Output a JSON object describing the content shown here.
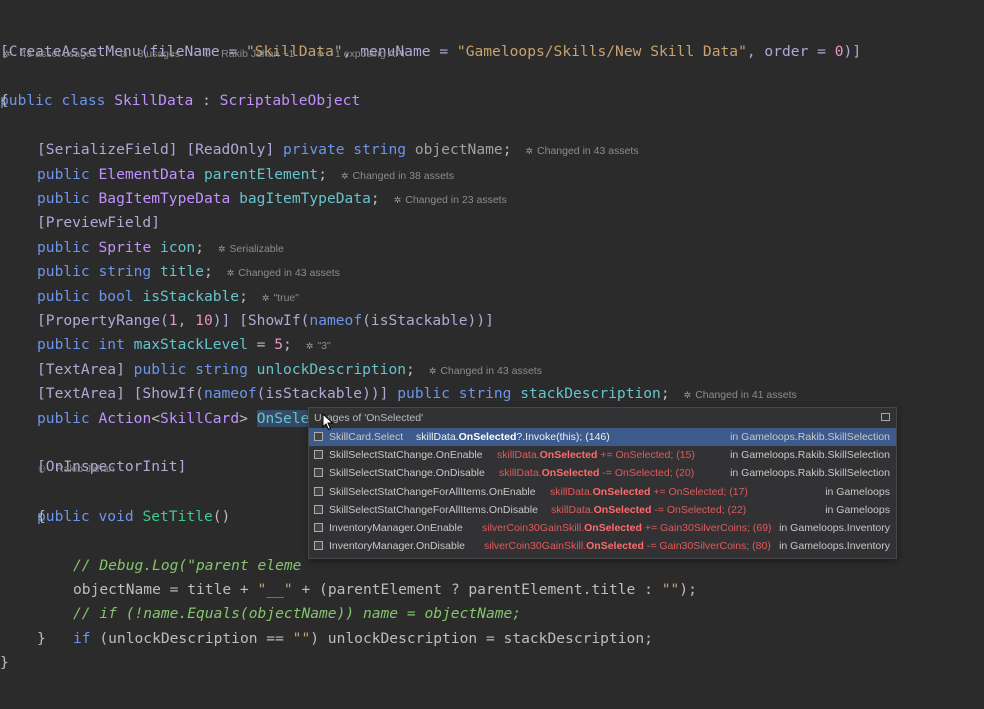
{
  "meta": {
    "asset_usages": "43 asset usages",
    "usages": "8 usages",
    "author": "Rakib Jahan +1",
    "exposing": "1 exposing API"
  },
  "code": {
    "attr_line": [
      "[CreateAssetMenu(fileName = ",
      "\"SkillData\"",
      ", menuName = ",
      "\"Gameloops/Skills/New Skill Data\"",
      ", order = ",
      "0",
      ")]"
    ],
    "class_kw": "public class ",
    "class_name": "SkillData",
    "class_sep": " : ",
    "class_base": "ScriptableObject",
    "open_brace": "{",
    "close_brace": "}",
    "inner_open": "{",
    "inner_close": "}",
    "l1": {
      "a": "[SerializeField] [ReadOnly] ",
      "b": "private string ",
      "c": "objectName",
      "d": ";",
      "hint": "Changed in 43 assets"
    },
    "l2": {
      "a": "public ",
      "b": "ElementData ",
      "c": "parentElement",
      "d": ";",
      "hint": "Changed in 38 assets"
    },
    "l3": {
      "a": "public ",
      "b": "BagItemTypeData ",
      "c": "bagItemTypeData",
      "d": ";",
      "hint": "Changed in 23 assets"
    },
    "l4": {
      "a": "[PreviewField]"
    },
    "l5": {
      "a": "public ",
      "b": "Sprite ",
      "c": "icon",
      "d": ";",
      "hint": "Serializable"
    },
    "l6": {
      "a": "public string ",
      "c": "title",
      "d": ";",
      "hint": "Changed in 43 assets"
    },
    "l7": {
      "a": "public bool ",
      "c": "isStackable",
      "d": ";",
      "hint": "\"true\""
    },
    "l8": {
      "a": "[PropertyRange(",
      "n1": "1",
      "s": ", ",
      "n2": "10",
      "b": ")] [ShowIf(",
      "k": "nameof",
      "c": "(isStackable))]"
    },
    "l9": {
      "a": "public int ",
      "c": "maxStackLevel",
      "e": " = ",
      "n": "5",
      "d": ";",
      "hint": "\"3\""
    },
    "l10": {
      "a": "[TextArea] ",
      "b": "public string ",
      "c": "unlockDescription",
      "d": ";",
      "hint": "Changed in 43 assets"
    },
    "l11": {
      "a": "[TextArea] [ShowIf(",
      "k": "nameof",
      "m": "(isStackable))] ",
      "b": "public string ",
      "c": "stackDescription",
      "d": ";",
      "hint": "Changed in 41 assets"
    },
    "l12": {
      "a": "public ",
      "b": "Action",
      "lt": "<",
      "t": "SkillCard",
      "gt": "> ",
      "c": "OnSelected",
      "d": ";"
    },
    "l13": {
      "a": "[OnInspectorInit]"
    },
    "l13_author": "Rakib Jahan",
    "l14": {
      "a": "public void ",
      "c": "SetTitle",
      "d": "()"
    },
    "l15": {
      "c": "// Debug.Log(\"parent eleme"
    },
    "l16": {
      "a": "objectName = title + ",
      "s": "\"__\"",
      "b": " + (parentElement ? parentElement.title : ",
      "s2": "\"\"",
      "d": ");"
    },
    "l17": {
      "c": "// if (!name.Equals(objectName)) name = objectName;"
    },
    "l18": {
      "a": "if ",
      "b": "(unlockDescription == ",
      "s": "\"\"",
      "d": ") unlockDescription = stackDescription;"
    }
  },
  "popup": {
    "title": "Usages of 'OnSelected'",
    "rows": [
      {
        "name": "SkillCard.Select",
        "pre": "skillData.",
        "bold": "OnSelected",
        "post": "?.Invoke(this); (146)",
        "loc": "in Gameloops.Rakib.SkillSelection"
      },
      {
        "name": "SkillSelectStatChange.OnEnable",
        "pre": "skillData.",
        "bold": "OnSelected",
        "post": " += OnSelected; (15)",
        "loc": "in Gameloops.Rakib.SkillSelection"
      },
      {
        "name": "SkillSelectStatChange.OnDisable",
        "pre": "skillData.",
        "bold": "OnSelected",
        "post": " -= OnSelected; (20)",
        "loc": "in Gameloops.Rakib.SkillSelection"
      },
      {
        "name": "SkillSelectStatChangeForAllItems.OnEnable",
        "pre": "skillData.",
        "bold": "OnSelected",
        "post": " += OnSelected; (17)",
        "loc": "in Gameloops"
      },
      {
        "name": "SkillSelectStatChangeForAllItems.OnDisable",
        "pre": "skillData.",
        "bold": "OnSelected",
        "post": " -= OnSelected; (22)",
        "loc": "in Gameloops"
      },
      {
        "name": "InventoryManager.OnEnable",
        "pre": "silverCoin30GainSkill.",
        "bold": "OnSelected",
        "post": " += Gain30SilverCoins; (69)",
        "loc": "in Gameloops.Inventory"
      },
      {
        "name": "InventoryManager.OnDisable",
        "pre": "silverCoin30GainSkill.",
        "bold": "OnSelected",
        "post": " -= Gain30SilverCoins; (80)",
        "loc": "in Gameloops.Inventory"
      }
    ]
  },
  "icons": {
    "hint": "unity-icon",
    "cursor": "mouse-cursor-icon"
  },
  "colors": {
    "selection": "#3d5a8c",
    "background": "#2b2b2c"
  }
}
